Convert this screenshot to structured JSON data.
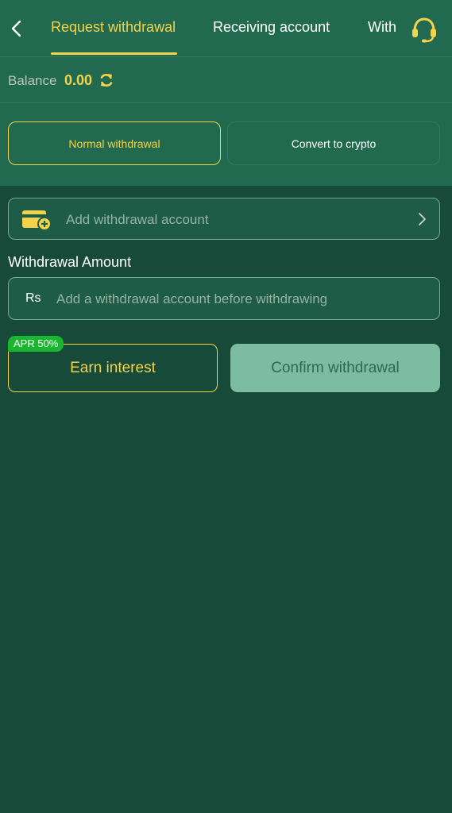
{
  "header": {
    "tabs": [
      {
        "label": "Request withdrawal",
        "active": true
      },
      {
        "label": "Receiving account",
        "active": false
      },
      {
        "label": "With",
        "active": false
      }
    ],
    "back_icon": "chevron-left-icon",
    "support_icon": "headset-icon"
  },
  "balance": {
    "label": "Balance",
    "value": "0.00",
    "refresh_icon": "refresh-icon"
  },
  "withdrawal_types": [
    {
      "label": "Normal withdrawal",
      "selected": true
    },
    {
      "label": "Convert to crypto",
      "selected": false
    }
  ],
  "account": {
    "label": "Add withdrawal account",
    "icon": "wallet-add-icon"
  },
  "amount": {
    "title": "Withdrawal Amount",
    "currency": "Rs",
    "placeholder": "Add a withdrawal account before withdrawing",
    "value": ""
  },
  "actions": {
    "apr_badge": "APR 50%",
    "earn_label": "Earn interest",
    "confirm_label": "Confirm withdrawal"
  },
  "colors": {
    "accent": "#f3d34a",
    "header_bg": "#226a4f",
    "page_bg": "#184a3a",
    "badge_green": "#19b72f",
    "confirm_bg": "#7bbca2"
  }
}
